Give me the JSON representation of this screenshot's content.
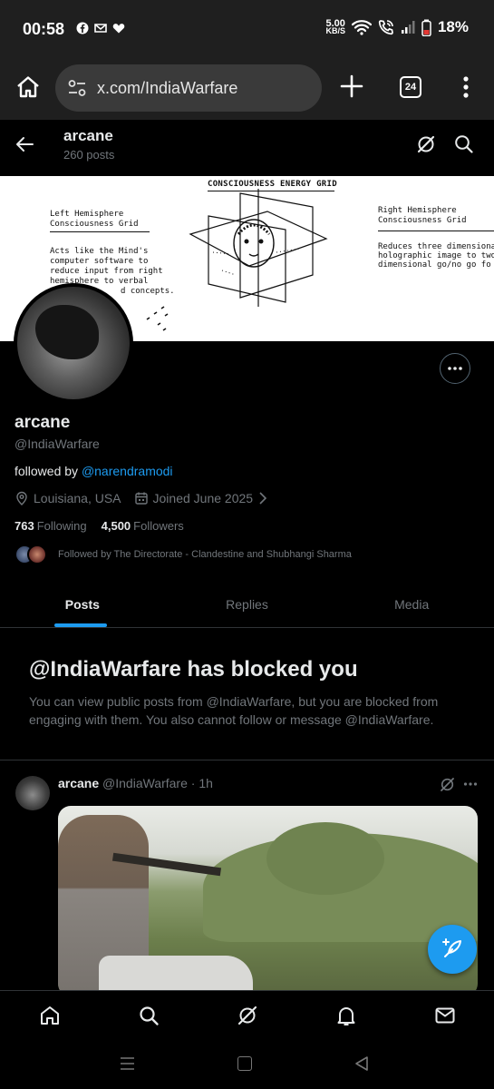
{
  "status": {
    "time": "00:58",
    "net_speed_value": "5.00",
    "net_speed_unit": "KB/S",
    "battery": "18%",
    "battery_color": "#e53935"
  },
  "browser": {
    "url": "x.com/IndiaWarfare",
    "tab_count": "24"
  },
  "topbar": {
    "name": "arcane",
    "posts_count": "260 posts"
  },
  "banner": {
    "title": "CONSCIOUSNESS ENERGY GRID",
    "left_head_1": "Left Hemisphere",
    "left_head_2": "Consciousness Grid",
    "left_body_1": "Acts like the Mind's",
    "left_body_2": "computer software to",
    "left_body_3": "reduce input from right",
    "left_body_4": "hemisphere to verbal",
    "left_body_5": "d concepts.",
    "right_head_1": "Right Hemisphere",
    "right_head_2": "Consciousness Grid",
    "right_body_1": "Reduces three dimensiona",
    "right_body_2": "holographic image to two",
    "right_body_3": "dimensional go/no go fo"
  },
  "profile": {
    "name": "arcane",
    "handle": "@IndiaWarfare",
    "followed_by_prefix": "followed by ",
    "followed_by_mention": "@narendramodi",
    "location": "Louisiana, USA",
    "joined": "Joined June 2025",
    "following_count": "763",
    "following_label": "Following",
    "followers_count": "4,500",
    "followers_label": "Followers",
    "mutuals_text": "Followed by The Directorate - Clandestine and Shubhangi Sharma"
  },
  "tabs": [
    {
      "label": "Posts",
      "active": true
    },
    {
      "label": "Replies",
      "active": false
    },
    {
      "label": "Media",
      "active": false
    }
  ],
  "blocked": {
    "title": "@IndiaWarfare has blocked you",
    "text": "You can view public posts from @IndiaWarfare, but you are blocked from engaging with them. You also cannot follow or message @IndiaWarfare."
  },
  "post": {
    "author": "arcane",
    "handle": "@IndiaWarfare",
    "separator": "·",
    "time": "1h"
  },
  "colors": {
    "accent": "#1d9bf0",
    "muted": "#71767b",
    "text": "#e7e9ea",
    "border": "#2f3336"
  },
  "icons": {
    "status": [
      "facebook-icon",
      "gmail-icon",
      "heart-icon",
      "wifi-icon",
      "wifi-call-icon",
      "signal-icon",
      "battery-icon"
    ],
    "browser": [
      "home-icon",
      "site-settings-icon",
      "plus-icon",
      "tab-switcher-icon",
      "overflow-menu-icon"
    ],
    "bottom_nav": [
      "home-icon",
      "search-icon",
      "grok-icon",
      "notifications-icon",
      "messages-icon"
    ]
  }
}
